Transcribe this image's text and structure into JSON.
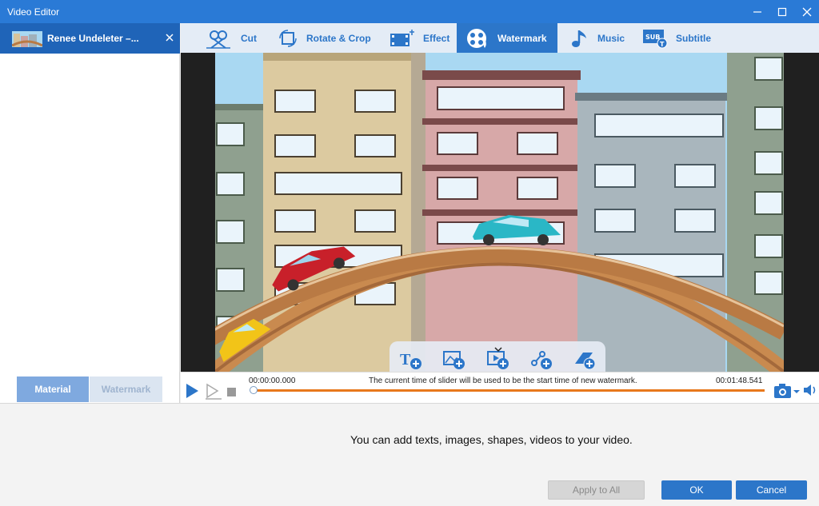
{
  "window": {
    "title": "Video Editor"
  },
  "file": {
    "name": "Renee Undeleter –..."
  },
  "toolbar": {
    "items": [
      {
        "label": "Cut",
        "icon": "cut-icon"
      },
      {
        "label": "Rotate & Crop",
        "icon": "rotate-crop-icon"
      },
      {
        "label": "Effect",
        "icon": "effect-icon"
      },
      {
        "label": "Watermark",
        "icon": "watermark-icon",
        "active": true
      },
      {
        "label": "Music",
        "icon": "music-note-icon"
      },
      {
        "label": "Subtitle",
        "icon": "subtitle-icon"
      }
    ]
  },
  "side_tabs": {
    "material": "Material",
    "watermark": "Watermark"
  },
  "timeline": {
    "start": "00:00:00.000",
    "end": "00:01:48.541",
    "message": "The current time of slider will be used to be the start time of new watermark.",
    "progress": 0
  },
  "watermark_tools": [
    "add-text-icon",
    "add-image-icon",
    "add-video-icon",
    "add-shape-icon",
    "add-3d-icon"
  ],
  "info": {
    "text": "You can add texts, images, shapes, videos to your video."
  },
  "buttons": {
    "apply_all": "Apply to All",
    "ok": "OK",
    "cancel": "Cancel"
  },
  "colors": {
    "accent": "#2c76c9",
    "title_bar": "#2a7ad6",
    "progress": "#e8781c"
  }
}
